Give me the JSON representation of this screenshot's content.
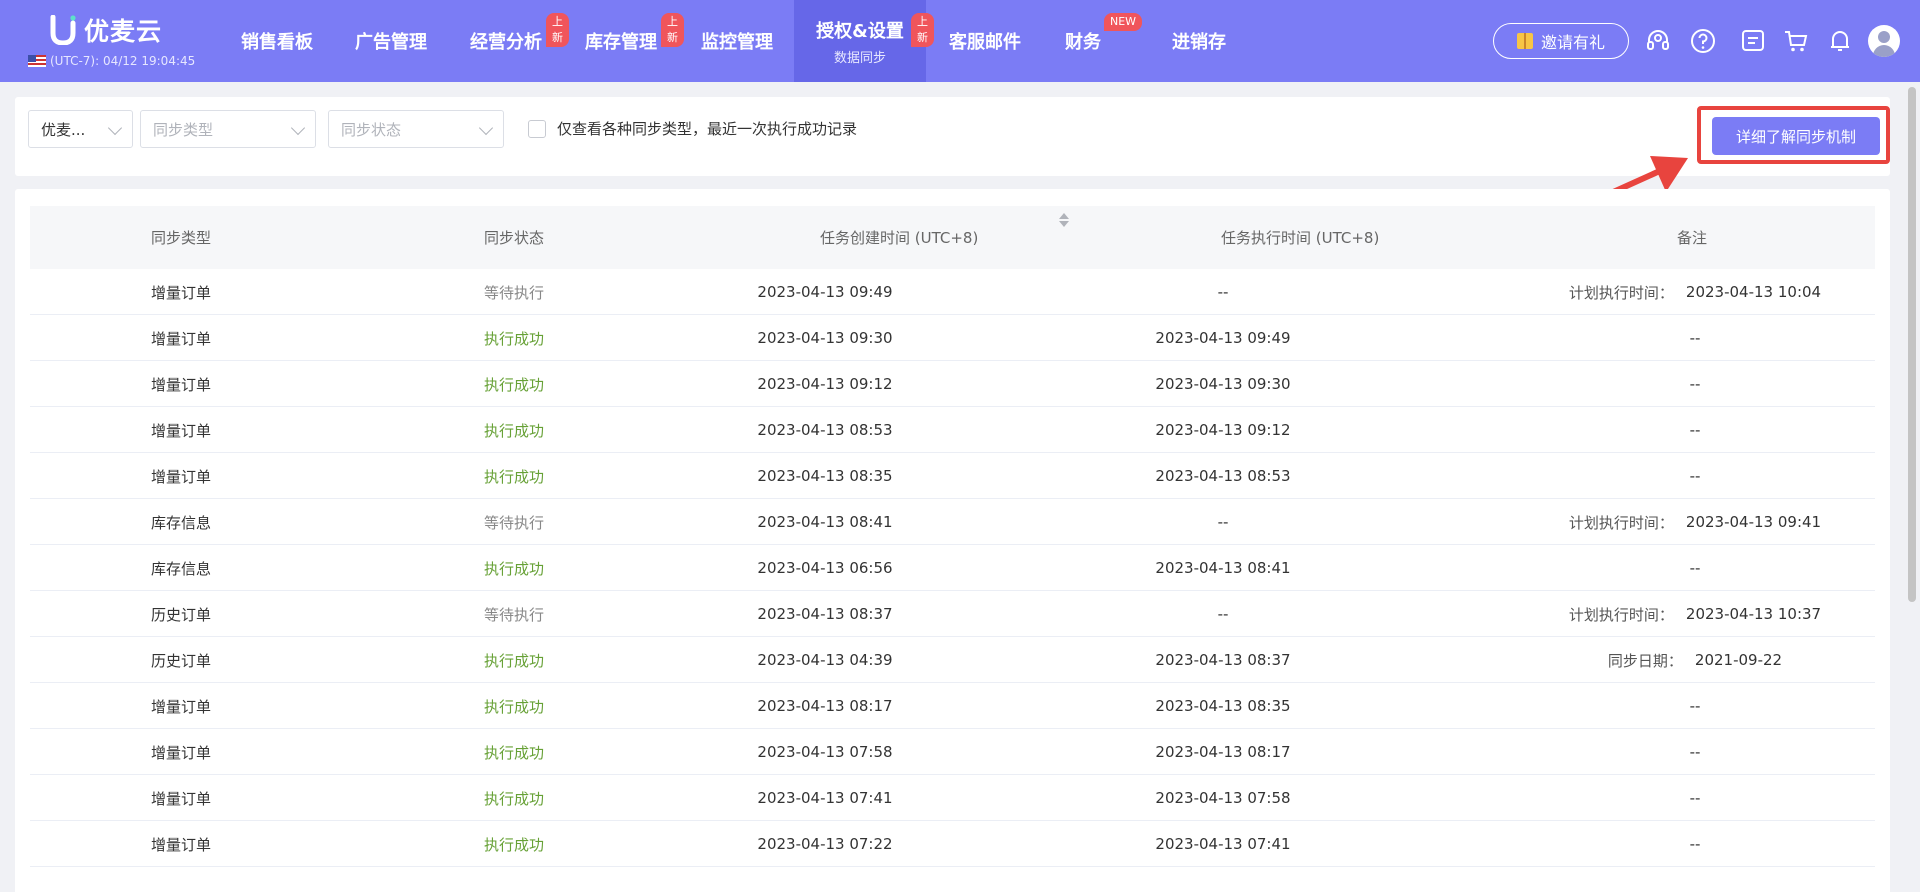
{
  "app": {
    "name": "优麦云",
    "timezone_label": "(UTC-7): 04/12 19:04:45"
  },
  "nav": {
    "items": [
      {
        "label": "销售看板",
        "badge": "",
        "sub": ""
      },
      {
        "label": "广告管理",
        "badge": "",
        "sub": ""
      },
      {
        "label": "经营分析",
        "badge": "上新",
        "sub": ""
      },
      {
        "label": "库存管理",
        "badge": "上新",
        "sub": ""
      },
      {
        "label": "监控管理",
        "badge": "",
        "sub": ""
      },
      {
        "label": "授权&设置",
        "badge": "上新",
        "sub": "数据同步"
      },
      {
        "label": "客服邮件",
        "badge": "",
        "sub": ""
      },
      {
        "label": "财务",
        "badge": "NEW",
        "sub": ""
      },
      {
        "label": "进销存",
        "badge": "",
        "sub": ""
      }
    ],
    "active_index": 5
  },
  "header_actions": {
    "invite_label": "邀请有礼",
    "icons": [
      "headset-icon",
      "help-icon",
      "message-icon",
      "cart-icon",
      "bell-icon",
      "avatar"
    ]
  },
  "filters": {
    "shop_select": "优麦...",
    "type_placeholder": "同步类型",
    "status_placeholder": "同步状态",
    "checkbox_label": "仅查看各种同步类型，最近一次执行成功记录",
    "learn_button": "详细了解同步机制"
  },
  "table": {
    "headers": {
      "type": "同步类型",
      "status": "同步状态",
      "created": "任务创建时间 (UTC+8)",
      "executed": "任务执行时间 (UTC+8)",
      "note": "备注"
    },
    "rows": [
      {
        "type": "增量订单",
        "status": "等待执行",
        "status_kind": "wait",
        "created": "2023-04-13 09:49",
        "executed": "--",
        "note_label": "计划执行时间：",
        "note_value": "2023-04-13 10:04"
      },
      {
        "type": "增量订单",
        "status": "执行成功",
        "status_kind": "ok",
        "created": "2023-04-13 09:30",
        "executed": "2023-04-13 09:49",
        "note_label": "",
        "note_value": "--"
      },
      {
        "type": "增量订单",
        "status": "执行成功",
        "status_kind": "ok",
        "created": "2023-04-13 09:12",
        "executed": "2023-04-13 09:30",
        "note_label": "",
        "note_value": "--"
      },
      {
        "type": "增量订单",
        "status": "执行成功",
        "status_kind": "ok",
        "created": "2023-04-13 08:53",
        "executed": "2023-04-13 09:12",
        "note_label": "",
        "note_value": "--"
      },
      {
        "type": "增量订单",
        "status": "执行成功",
        "status_kind": "ok",
        "created": "2023-04-13 08:35",
        "executed": "2023-04-13 08:53",
        "note_label": "",
        "note_value": "--"
      },
      {
        "type": "库存信息",
        "status": "等待执行",
        "status_kind": "wait",
        "created": "2023-04-13 08:41",
        "executed": "--",
        "note_label": "计划执行时间：",
        "note_value": "2023-04-13 09:41"
      },
      {
        "type": "库存信息",
        "status": "执行成功",
        "status_kind": "ok",
        "created": "2023-04-13 06:56",
        "executed": "2023-04-13 08:41",
        "note_label": "",
        "note_value": "--"
      },
      {
        "type": "历史订单",
        "status": "等待执行",
        "status_kind": "wait",
        "created": "2023-04-13 08:37",
        "executed": "--",
        "note_label": "计划执行时间：",
        "note_value": "2023-04-13 10:37"
      },
      {
        "type": "历史订单",
        "status": "执行成功",
        "status_kind": "ok",
        "created": "2023-04-13 04:39",
        "executed": "2023-04-13 08:37",
        "note_label": "同步日期：",
        "note_value": "2021-09-22"
      },
      {
        "type": "增量订单",
        "status": "执行成功",
        "status_kind": "ok",
        "created": "2023-04-13 08:17",
        "executed": "2023-04-13 08:35",
        "note_label": "",
        "note_value": "--"
      },
      {
        "type": "增量订单",
        "status": "执行成功",
        "status_kind": "ok",
        "created": "2023-04-13 07:58",
        "executed": "2023-04-13 08:17",
        "note_label": "",
        "note_value": "--"
      },
      {
        "type": "增量订单",
        "status": "执行成功",
        "status_kind": "ok",
        "created": "2023-04-13 07:41",
        "executed": "2023-04-13 07:58",
        "note_label": "",
        "note_value": "--"
      },
      {
        "type": "增量订单",
        "status": "执行成功",
        "status_kind": "ok",
        "created": "2023-04-13 07:22",
        "executed": "2023-04-13 07:41",
        "note_label": "",
        "note_value": "--"
      }
    ]
  },
  "colors": {
    "brand": "#7b7cf5",
    "active_nav": "#6667e8",
    "success": "#67a136",
    "badge": "#f0555b",
    "highlight": "#e8443e"
  }
}
